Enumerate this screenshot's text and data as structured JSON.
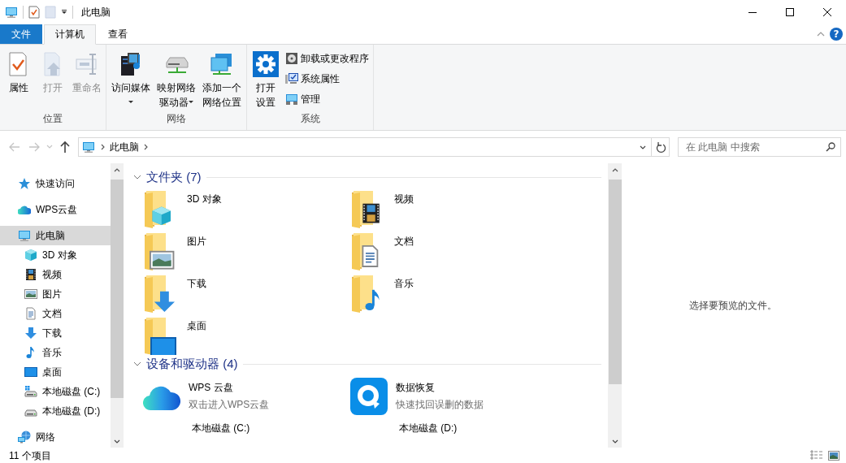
{
  "window": {
    "title": "此电脑"
  },
  "help_button": {
    "label": "?"
  },
  "tabs": [
    {
      "label": "文件",
      "kind": "file",
      "selected": false
    },
    {
      "label": "计算机",
      "kind": "tab",
      "selected": true
    },
    {
      "label": "查看",
      "kind": "tab",
      "selected": false
    }
  ],
  "ribbon": {
    "groups": [
      {
        "label": "位置",
        "buttons": [
          {
            "label": "属性",
            "kind": "large",
            "disabled": false,
            "has_menu": false
          },
          {
            "label": "打开",
            "kind": "large",
            "disabled": true,
            "has_menu": false
          },
          {
            "label": "重命名",
            "kind": "large",
            "disabled": true,
            "has_menu": false
          }
        ]
      },
      {
        "label": "网络",
        "buttons": [
          {
            "label": "访问媒体",
            "kind": "large",
            "disabled": false,
            "has_menu": true
          },
          {
            "label": "映射网络驱动器",
            "kind": "large",
            "disabled": false,
            "has_menu": true
          },
          {
            "label": "添加一个网络位置",
            "kind": "large",
            "disabled": false,
            "has_menu": false
          }
        ]
      },
      {
        "label": "系统",
        "buttons": [
          {
            "label": "打开设置",
            "kind": "narrow",
            "disabled": false,
            "has_menu": false
          },
          {
            "label": "卸载或更改程序",
            "kind": "small",
            "disabled": false,
            "has_menu": false
          },
          {
            "label": "系统属性",
            "kind": "small",
            "disabled": false,
            "has_menu": false
          },
          {
            "label": "管理",
            "kind": "small",
            "disabled": false,
            "has_menu": false
          }
        ]
      }
    ]
  },
  "address": {
    "path": [
      "此电脑"
    ]
  },
  "search": {
    "placeholder": "在 此电脑 中搜索"
  },
  "sidebar": {
    "items": [
      {
        "label": "快速访问",
        "selected": false
      },
      {
        "label": "WPS云盘",
        "selected": false
      },
      {
        "label": "此电脑",
        "selected": true,
        "children": [
          {
            "label": "3D 对象",
            "selected": false
          },
          {
            "label": "视频",
            "selected": false
          },
          {
            "label": "图片",
            "selected": false
          },
          {
            "label": "文档",
            "selected": false
          },
          {
            "label": "下载",
            "selected": false
          },
          {
            "label": "音乐",
            "selected": false
          },
          {
            "label": "桌面",
            "selected": false
          },
          {
            "label": "本地磁盘 (C:)",
            "selected": false
          },
          {
            "label": "本地磁盘 (D:)",
            "selected": false
          }
        ]
      },
      {
        "label": "网络",
        "selected": false
      }
    ]
  },
  "sections": [
    {
      "title": "文件夹 (7)",
      "items": [
        {
          "name": "3D 对象",
          "kind": "folder"
        },
        {
          "name": "视频",
          "kind": "folder"
        },
        {
          "name": "图片",
          "kind": "folder"
        },
        {
          "name": "文档",
          "kind": "folder"
        },
        {
          "name": "下载",
          "kind": "folder"
        },
        {
          "name": "音乐",
          "kind": "folder"
        },
        {
          "name": "桌面",
          "kind": "folder"
        }
      ]
    },
    {
      "title": "设备和驱动器 (4)",
      "items": [
        {
          "name": "WPS 云盘",
          "detail": "双击进入WPS云盘",
          "kind": "app"
        },
        {
          "name": "数据恢复",
          "detail": "快速找回误删的数据",
          "kind": "app"
        },
        {
          "name": "本地磁盘 (C:)",
          "kind": "drive"
        },
        {
          "name": "本地磁盘 (D:)",
          "kind": "drive"
        }
      ]
    }
  ],
  "preview": {
    "message": "选择要预览的文件。"
  },
  "status_bar": {
    "count": "11 个项目"
  }
}
